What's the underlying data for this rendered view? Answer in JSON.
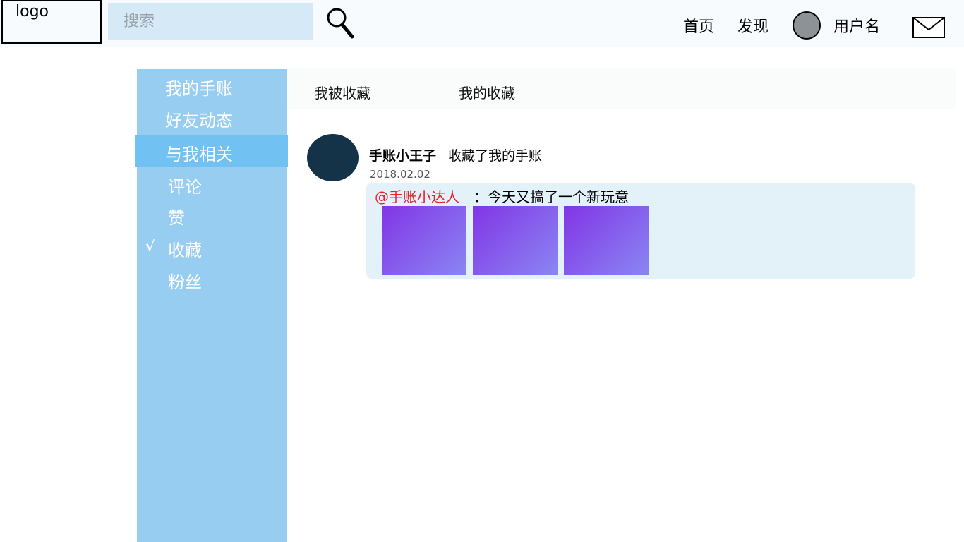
{
  "header": {
    "logo_text": "logo",
    "search_placeholder": "搜索",
    "nav": {
      "home": "首页",
      "discover": "发现"
    },
    "username": "用户名"
  },
  "sidebar": {
    "items": [
      {
        "label": "我的手账"
      },
      {
        "label": "好友动态"
      },
      {
        "label": "与我相关"
      },
      {
        "label": "评论"
      },
      {
        "label": "赞"
      },
      {
        "label": "收藏"
      },
      {
        "label": "粉丝"
      }
    ],
    "check_mark": "√"
  },
  "tabs": [
    {
      "label": "我被收藏"
    },
    {
      "label": "我的收藏"
    }
  ],
  "feed": {
    "user": "手账小王子",
    "action": "收藏了我的手账",
    "date": "2018.02.02",
    "mention": "@手账小达人",
    "text": "：今天又搞了一个新玩意"
  },
  "colors": {
    "sidebar_bg": "#98cdf2",
    "sidebar_active_bg": "#71c1f3",
    "mention": "#e8202b",
    "avatar": "#153348"
  }
}
